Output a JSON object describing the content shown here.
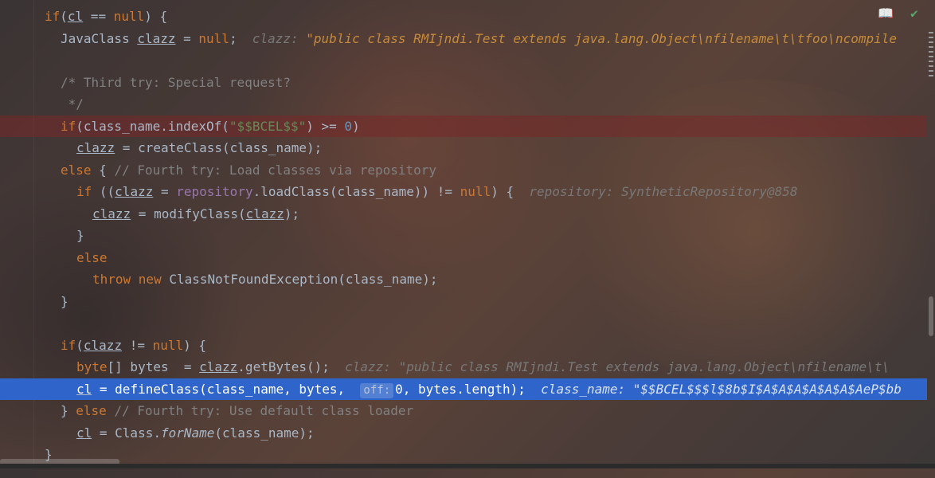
{
  "toolbar": {
    "reader_icon": "book-icon",
    "status_icon": "check-icon"
  },
  "code_lines": [
    {
      "t": "if(cl == null) {"
    },
    {
      "t": "JavaClass clazz = null;",
      "hint_label": "clazz:",
      "hint_value": "\"public class RMIjndi.Test extends java.lang.Object\\nfilename\\t\\tfoo\\ncompile"
    },
    {
      "t": ""
    },
    {
      "t": "/* Third try: Special request?"
    },
    {
      "t": " */"
    },
    {
      "t": "if(class_name.indexOf(\"$$BCEL$$\") >= 0)"
    },
    {
      "t": "clazz = createClass(class_name);"
    },
    {
      "t": "else { // Fourth try: Load classes via repository"
    },
    {
      "t": "if ((clazz = repository.loadClass(class_name)) != null) {",
      "hint": "repository: SyntheticRepository@858"
    },
    {
      "t": "clazz = modifyClass(clazz);"
    },
    {
      "t": "}"
    },
    {
      "t": "else"
    },
    {
      "t": "throw new ClassNotFoundException(class_name);"
    },
    {
      "t": "}"
    },
    {
      "t": ""
    },
    {
      "t": "if(clazz != null) {"
    },
    {
      "t": "byte[] bytes  = clazz.getBytes();",
      "hint": "clazz: \"public class RMIjndi.Test extends java.lang.Object\\nfilename\\t\\"
    },
    {
      "t": "cl = defineClass(class_name, bytes, 0, bytes.length);",
      "param_hint": "off:",
      "hint": "class_name: \"$$BCEL$$$l$8b$I$A$A$A$A$A$A$AeP$bb"
    },
    {
      "t": "} else // Fourth try: Use default class loader"
    },
    {
      "t": "cl = Class.forName(class_name);"
    },
    {
      "t": "}"
    }
  ],
  "colors": {
    "keyword": "#cc7832",
    "number": "#6897bb",
    "string": "#6a8759",
    "comment": "#808080",
    "field": "#9876aa",
    "text": "#a9b7c6",
    "breakpoint_line": "#782828",
    "execution_line": "#2f65ca"
  }
}
